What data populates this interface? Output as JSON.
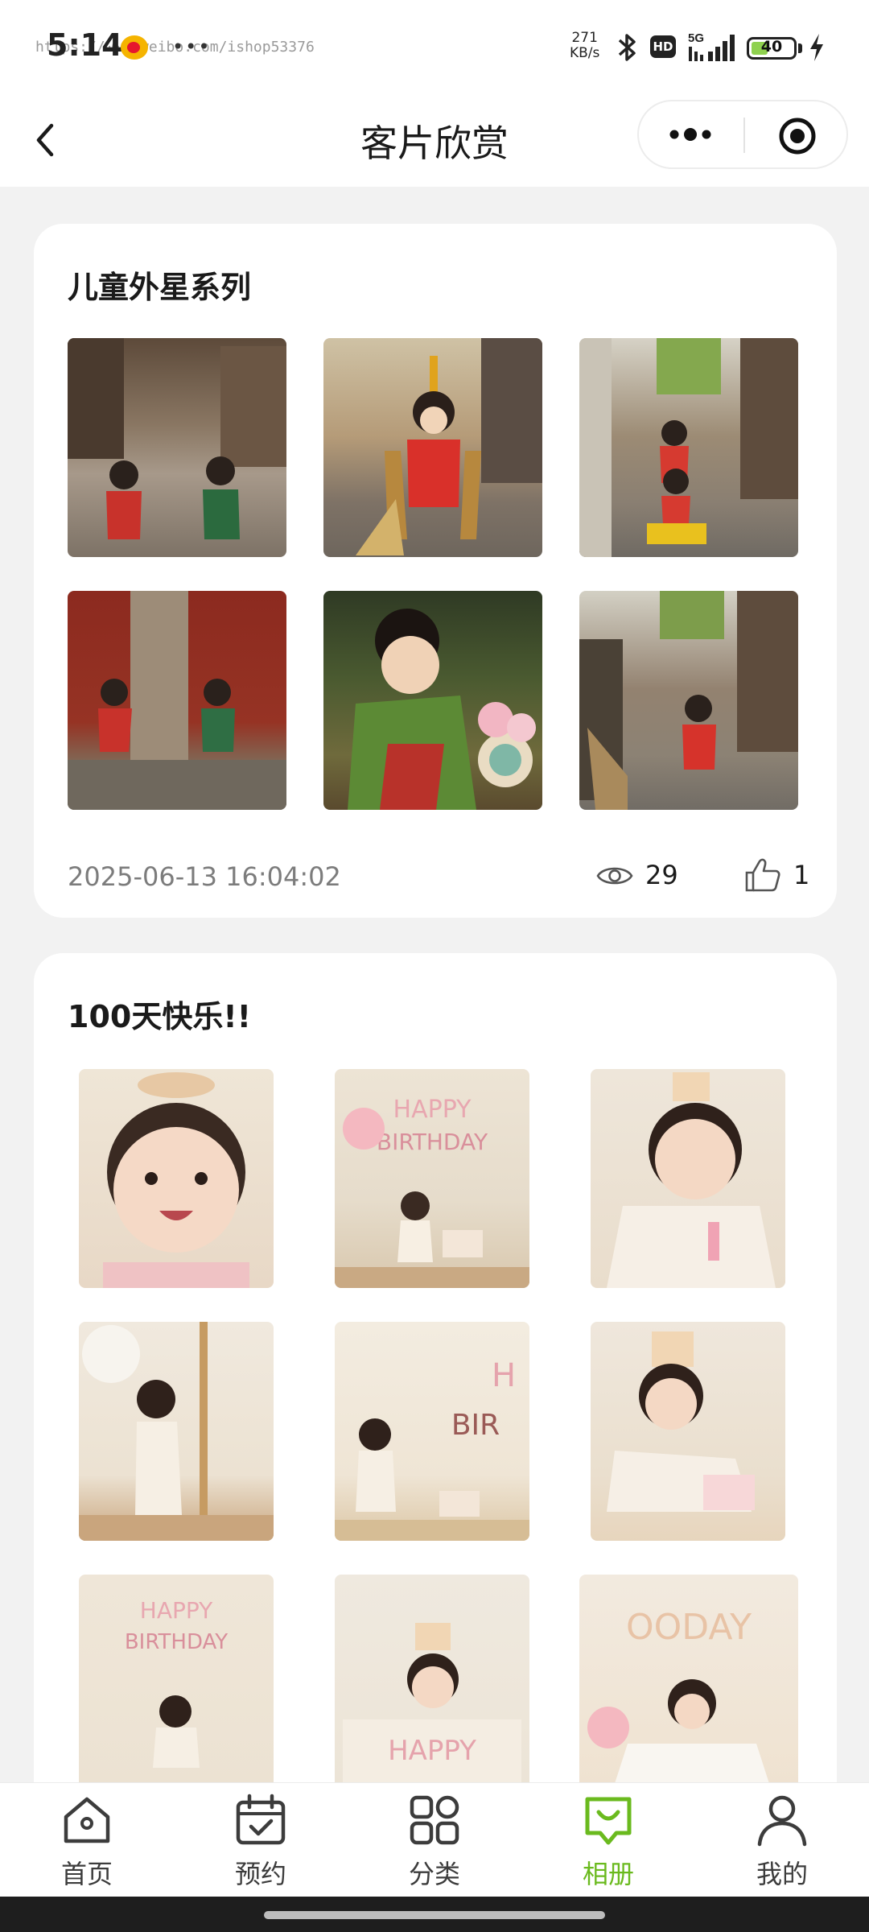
{
  "status_bar": {
    "time": "5:14",
    "watermark": "https://www.weibo.com/ishop53376",
    "network_speed_value": "271",
    "network_speed_unit": "KB/s",
    "hd_label": "HD",
    "network_type": "5G",
    "battery_level": "40"
  },
  "nav": {
    "title": "客片欣赏"
  },
  "albums": [
    {
      "title": "儿童外星系列",
      "date": "2025-06-13 16:04:02",
      "views": "29",
      "likes": "1"
    },
    {
      "title": "100天快乐!!"
    }
  ],
  "tabs": [
    {
      "label": "首页",
      "icon": "home-icon"
    },
    {
      "label": "预约",
      "icon": "calendar-check-icon"
    },
    {
      "label": "分类",
      "icon": "category-grid-icon"
    },
    {
      "label": "相册",
      "icon": "album-icon"
    },
    {
      "label": "我的",
      "icon": "person-icon"
    }
  ],
  "colors": {
    "accent": "#6aba1e",
    "background": "#f2f2f2",
    "card": "#ffffff"
  }
}
